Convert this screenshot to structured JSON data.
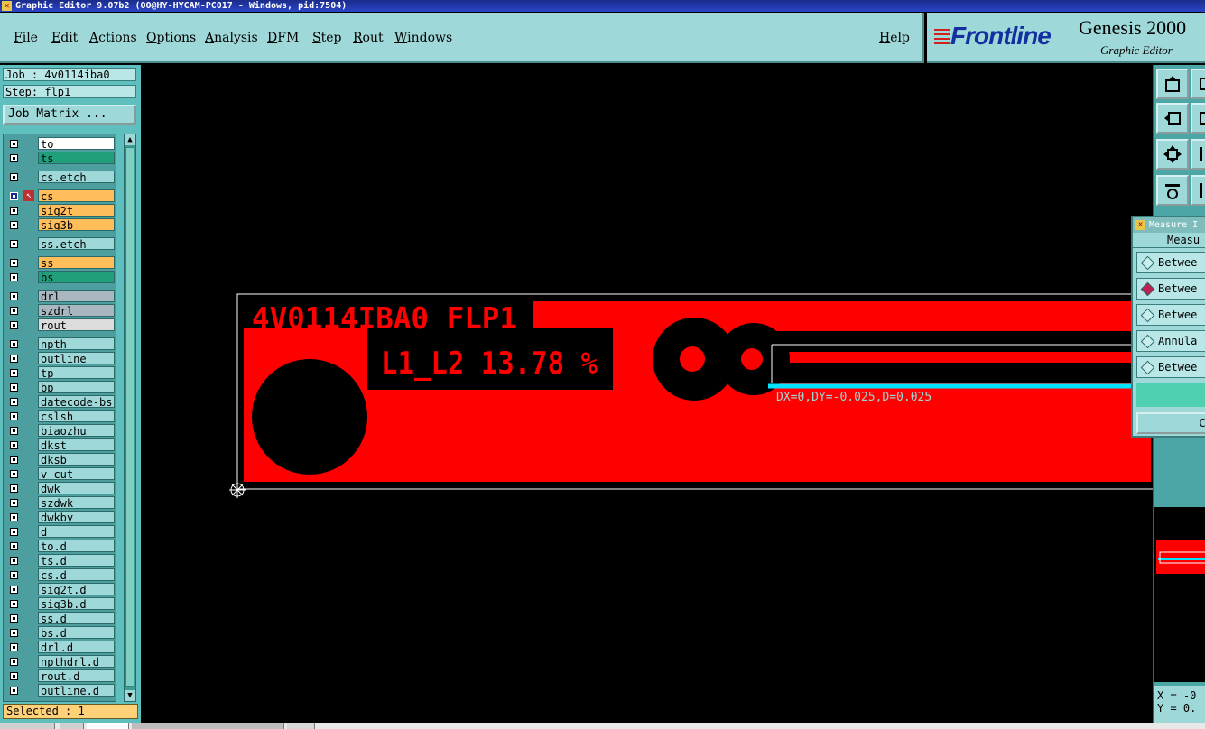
{
  "window": {
    "title": "Graphic Editor 9.07b2 (OO@HY-HYCAM-PC017 - Windows, pid:7504)"
  },
  "menu": [
    {
      "label": "File"
    },
    {
      "label": "Edit"
    },
    {
      "label": "Actions"
    },
    {
      "label": "Options"
    },
    {
      "label": "Analysis"
    },
    {
      "label": "DFM"
    },
    {
      "label": "Step"
    },
    {
      "label": "Rout"
    },
    {
      "label": "Windows"
    }
  ],
  "menu_help": "Help",
  "brand": {
    "logo": "Frontline",
    "product": "Genesis 2000",
    "subtitle": "Graphic Editor"
  },
  "job": {
    "job_line": "Job : 4v0114iba0",
    "step_line": "Step: flp1",
    "matrix_button": "Job Matrix ..."
  },
  "layers": [
    {
      "name": "to",
      "color": "#ffffff"
    },
    {
      "name": "ts",
      "color": "#1fa07a"
    },
    {
      "name": "cs.etch",
      "color": "#9fd8d8"
    },
    {
      "name": "cs",
      "color": "#ffbe5a",
      "active": true
    },
    {
      "name": "sig2t",
      "color": "#ffbe5a"
    },
    {
      "name": "sig3b",
      "color": "#ffbe5a"
    },
    {
      "name": "ss.etch",
      "color": "#9fd8d8"
    },
    {
      "name": "ss",
      "color": "#ffbe5a"
    },
    {
      "name": "bs",
      "color": "#1fa07a"
    },
    {
      "name": "drl",
      "color": "#a9b8c0"
    },
    {
      "name": "szdrl",
      "color": "#a9b8c0"
    },
    {
      "name": "rout",
      "color": "#dcdcdc"
    },
    {
      "name": "npth",
      "color": "#9fd8d8"
    },
    {
      "name": "outline",
      "color": "#9fd8d8"
    },
    {
      "name": "tp",
      "color": "#9fd8d8"
    },
    {
      "name": "bp",
      "color": "#9fd8d8"
    },
    {
      "name": "datecode-bs",
      "color": "#9fd8d8"
    },
    {
      "name": "cslsh",
      "color": "#9fd8d8"
    },
    {
      "name": "biaozhu",
      "color": "#9fd8d8"
    },
    {
      "name": "dkst",
      "color": "#9fd8d8"
    },
    {
      "name": "dksb",
      "color": "#9fd8d8"
    },
    {
      "name": "v-cut",
      "color": "#9fd8d8"
    },
    {
      "name": "dwk",
      "color": "#9fd8d8"
    },
    {
      "name": "szdwk",
      "color": "#9fd8d8"
    },
    {
      "name": "dwkby",
      "color": "#9fd8d8"
    },
    {
      "name": "d",
      "color": "#9fd8d8"
    },
    {
      "name": "to.d",
      "color": "#9fd8d8"
    },
    {
      "name": "ts.d",
      "color": "#9fd8d8"
    },
    {
      "name": "cs.d",
      "color": "#9fd8d8"
    },
    {
      "name": "sig2t.d",
      "color": "#9fd8d8"
    },
    {
      "name": "sig3b.d",
      "color": "#9fd8d8"
    },
    {
      "name": "ss.d",
      "color": "#9fd8d8"
    },
    {
      "name": "bs.d",
      "color": "#9fd8d8"
    },
    {
      "name": "drl.d",
      "color": "#9fd8d8"
    },
    {
      "name": "npthdrl.d",
      "color": "#9fd8d8"
    },
    {
      "name": "rout.d",
      "color": "#9fd8d8"
    },
    {
      "name": "outline.d",
      "color": "#9fd8d8"
    }
  ],
  "selected_text": "Selected : 1",
  "canvas": {
    "board_label": "4V0114IBA0 FLP1",
    "layer_label": "L1_L2 13.78 %",
    "measure_readout": "DX=0,DY=-0.025,D=0.025",
    "copper_color": "#ff0000",
    "measure_color": "#00e5ff"
  },
  "measure_dialog": {
    "title": "Measure I",
    "heading": "Measu",
    "options": [
      {
        "label": "Betwee",
        "selected": false
      },
      {
        "label": "Betwee",
        "selected": true
      },
      {
        "label": "Betwee",
        "selected": false
      },
      {
        "label": "Annula",
        "selected": false
      },
      {
        "label": "Betwee",
        "selected": false
      }
    ],
    "close_label": "C"
  },
  "coords": {
    "x": "X = -0",
    "y": "Y = 0."
  },
  "tools": [
    "move-icon",
    "copy-icon",
    "resize-icon",
    "window-icon",
    "center-icon",
    "fit-icon",
    "tools-icon",
    "split-icon"
  ]
}
